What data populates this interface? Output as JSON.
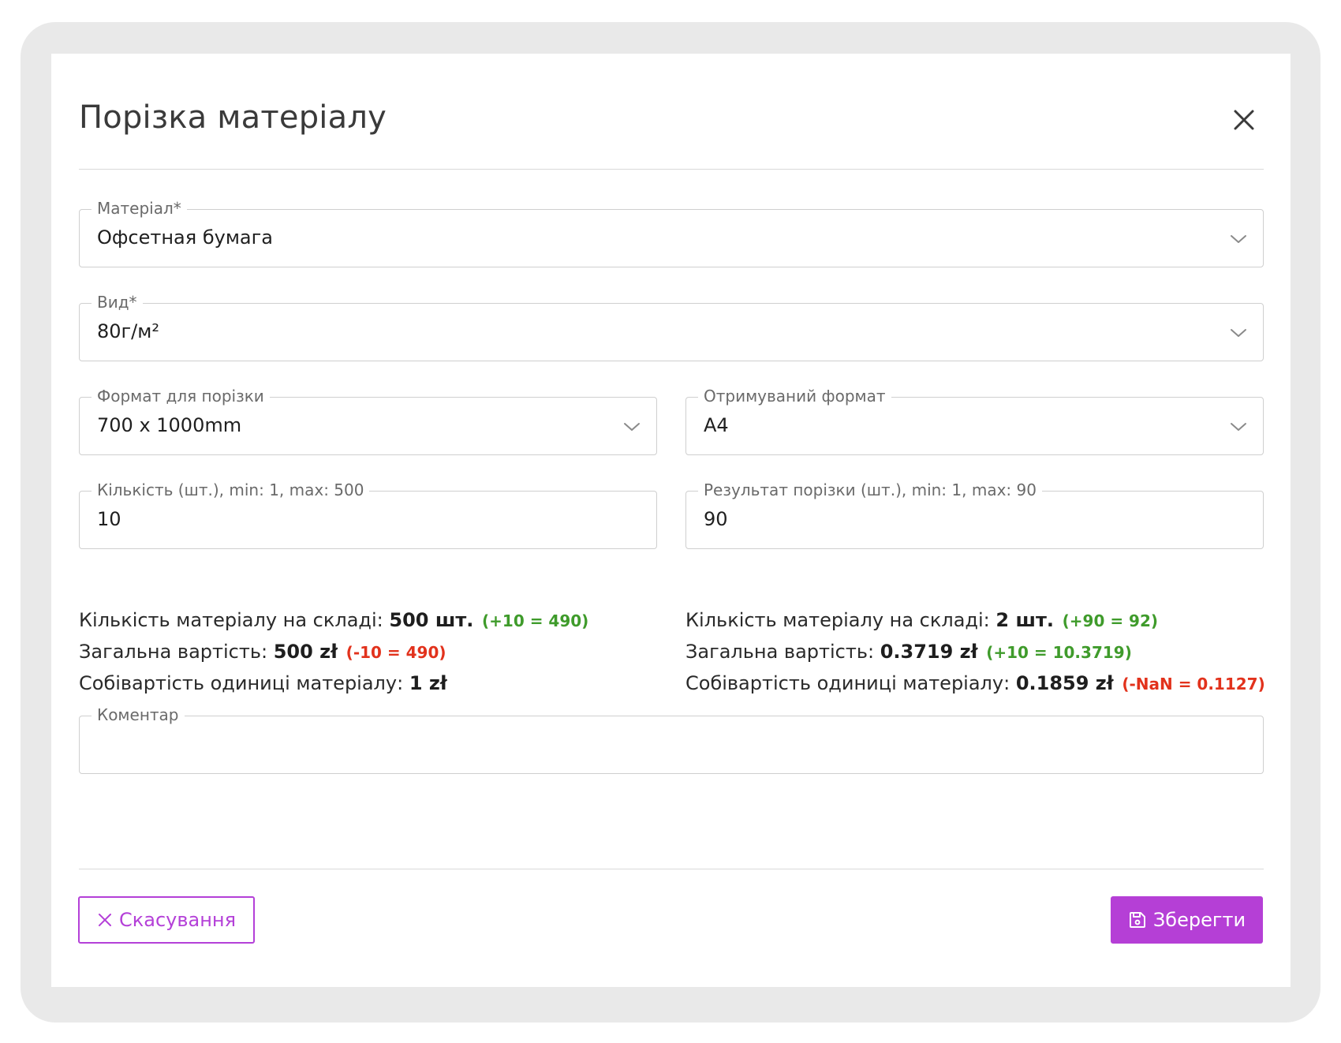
{
  "dialog": {
    "title": "Порізка матеріалу"
  },
  "form": {
    "material": {
      "label": "Матеріал*",
      "value": "Офсетная бумага"
    },
    "type": {
      "label": "Вид*",
      "value": "80г/м²"
    },
    "source_format": {
      "label": "Формат для порізки",
      "value": "700 x 1000mm"
    },
    "target_format": {
      "label": "Отримуваний формат",
      "value": "A4"
    },
    "quantity": {
      "label": "Кількість (шт.), min: 1, max: 500",
      "value": "10"
    },
    "result": {
      "label": "Результат порізки (шт.), min: 1, max: 90",
      "value": "90"
    },
    "comment": {
      "label": "Коментар",
      "value": ""
    }
  },
  "source_info": {
    "stock_label": "Кількість матеріалу на складі:",
    "stock_value": "500 шт.",
    "stock_delta": "(+10 = 490)",
    "total_label": "Загальна вартість:",
    "total_value": "500 zł",
    "total_delta": "(-10 = 490)",
    "unit_label": "Собівартість одиниці матеріалу:",
    "unit_value": "1 zł"
  },
  "target_info": {
    "stock_label": "Кількість матеріалу на складі:",
    "stock_value": "2 шт.",
    "stock_delta": "(+90 = 92)",
    "total_label": "Загальна вартість:",
    "total_value": "0.3719 zł",
    "total_delta": "(+10 = 10.3719)",
    "unit_label": "Собівартість одиниці матеріалу:",
    "unit_value": "0.1859 zł",
    "unit_delta": "(-NaN = 0.1127)"
  },
  "footer": {
    "cancel_label": "Скасування",
    "save_label": "Зберегти"
  },
  "icons": {
    "close": "close-icon",
    "chevron": "chevron-down-icon",
    "cancel": "x-icon",
    "save": "floppy-disk-icon"
  },
  "colors": {
    "accent": "#b53fd6",
    "positive": "#3f9b2b",
    "negative": "#e2321c",
    "frame": "#e9e9e9"
  }
}
